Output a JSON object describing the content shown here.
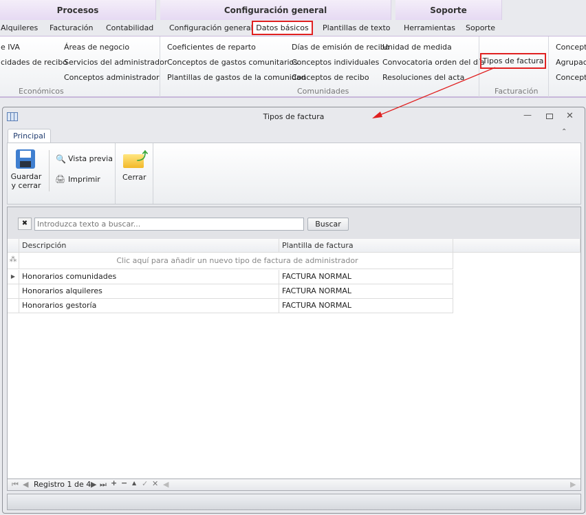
{
  "ribbon": {
    "groups": [
      "Procesos",
      "Configuración general",
      "Soporte"
    ],
    "tabs": [
      "Alquileres",
      "Facturación",
      "Contabilidad",
      "Configuración general",
      "Datos básicos",
      "Plantillas de texto",
      "Herramientas",
      "Soporte"
    ],
    "economicos": {
      "items": [
        "e IVA",
        "cidades de recibo",
        "Áreas de negocio",
        "Servicios del administrador",
        "Conceptos administrador"
      ],
      "label": "Económicos"
    },
    "comunidades": {
      "items": [
        "Coeficientes de reparto",
        "Conceptos de gastos comunitarios",
        "Plantillas de gastos de la comunidad",
        "Días de emisión de recibo",
        "Conceptos individuales",
        "Conceptos de recibo",
        "Unidad de medida",
        "Convocatoria orden del día",
        "Resoluciones del acta"
      ],
      "label": "Comunidades"
    },
    "facturacion": {
      "items": [
        "Tipos de factura"
      ],
      "label": "Facturación"
    },
    "extra": [
      "Concepto",
      "Agrupacio",
      "Concepto"
    ]
  },
  "window": {
    "title": "Tipos de factura",
    "tab": "Principal",
    "toolbar": {
      "save": "Guardar",
      "save2": "y cerrar",
      "preview": "Vista previa",
      "print": "Imprimir",
      "close": "Cerrar"
    },
    "search": {
      "placeholder": "Introduzca texto a buscar...",
      "button": "Buscar"
    },
    "grid": {
      "columns": [
        "Descripción",
        "Plantilla de factura"
      ],
      "new_row": "Clic aquí para añadir un nuevo tipo de factura de administrador",
      "rows": [
        [
          "Honorarios comunidades",
          "FACTURA NORMAL"
        ],
        [
          "Honorarios alquileres",
          "FACTURA NORMAL"
        ],
        [
          "Honorarios gestoría",
          "FACTURA NORMAL"
        ]
      ]
    },
    "navigator": "Registro 1 de 4"
  },
  "colors": {
    "highlight": "#e02020"
  }
}
